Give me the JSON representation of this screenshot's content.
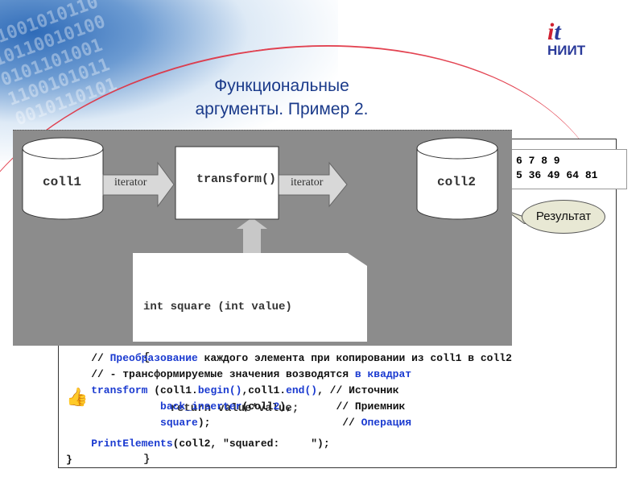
{
  "slide": {
    "title_line1": "Функциональные",
    "title_line2": "аргументы. Пример 2.",
    "logo_text": "НИИТ",
    "logo_mark": "it"
  },
  "diagram": {
    "source": "coll1",
    "dest": "coll2",
    "function": "transform()",
    "arrow_label_left": "iterator",
    "arrow_label_right": "iterator",
    "snippet": [
      "int square (int value)",
      "{",
      "    return value*value;",
      "}"
    ]
  },
  "output": {
    "line1": "6 7 8 9",
    "line2": "5 36 49 64 81"
  },
  "callout": {
    "label": "Результат"
  },
  "colors": {
    "keyword": "#1a3ad0",
    "text": "#111111",
    "title": "#1a3a8a"
  },
  "code": {
    "lines": [
      [
        {
          "t": "    // ",
          "c": "text"
        },
        {
          "t": "Преобразование",
          "c": "keyword"
        },
        {
          "t": " каждого элемента при копировании из coll1 в coll2",
          "c": "text"
        }
      ],
      [
        {
          "t": "    // - трансформируемые значения возводятся ",
          "c": "text"
        },
        {
          "t": "в квадрат",
          "c": "keyword"
        }
      ],
      [
        {
          "t": "    transform",
          "c": "keyword"
        },
        {
          "t": " (coll1.",
          "c": "text"
        },
        {
          "t": "begin()",
          "c": "keyword"
        },
        {
          "t": ",coll1.",
          "c": "text"
        },
        {
          "t": "end()",
          "c": "keyword"
        },
        {
          "t": ", // Источник",
          "c": "text"
        }
      ],
      [
        {
          "t": "               back_inserter",
          "c": "keyword"
        },
        {
          "t": "(coll",
          "c": "text"
        },
        {
          "t": "2",
          "c": "keyword"
        },
        {
          "t": "),       // Приемник",
          "c": "text"
        }
      ],
      [
        {
          "t": "               square",
          "c": "keyword"
        },
        {
          "t": ");                     // ",
          "c": "text"
        },
        {
          "t": "Операция",
          "c": "keyword"
        }
      ],
      [],
      [
        {
          "t": "    PrintElements",
          "c": "keyword"
        },
        {
          "t": "(coll2, \"squared:     \");",
          "c": "text"
        }
      ],
      [
        {
          "t": "}",
          "c": "text"
        }
      ]
    ]
  }
}
